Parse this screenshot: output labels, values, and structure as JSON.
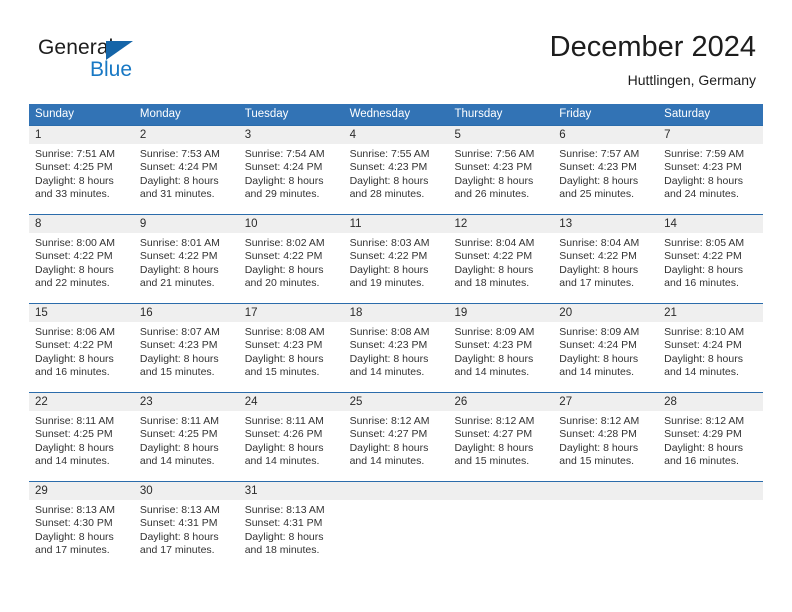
{
  "brand": {
    "word1": "General",
    "word2": "Blue",
    "triangle_color": "#1565a8",
    "blue_text_color": "#1878c4"
  },
  "header": {
    "title": "December 2024",
    "subtitle": "Huttlingen, Germany",
    "accent_color": "#3273b5",
    "daynum_band_color": "#efefef"
  },
  "weekdays": [
    "Sunday",
    "Monday",
    "Tuesday",
    "Wednesday",
    "Thursday",
    "Friday",
    "Saturday"
  ],
  "weeks": [
    [
      {
        "day": "1",
        "sunrise": "Sunrise: 7:51 AM",
        "sunset": "Sunset: 4:25 PM",
        "daylight1": "Daylight: 8 hours",
        "daylight2": "and 33 minutes."
      },
      {
        "day": "2",
        "sunrise": "Sunrise: 7:53 AM",
        "sunset": "Sunset: 4:24 PM",
        "daylight1": "Daylight: 8 hours",
        "daylight2": "and 31 minutes."
      },
      {
        "day": "3",
        "sunrise": "Sunrise: 7:54 AM",
        "sunset": "Sunset: 4:24 PM",
        "daylight1": "Daylight: 8 hours",
        "daylight2": "and 29 minutes."
      },
      {
        "day": "4",
        "sunrise": "Sunrise: 7:55 AM",
        "sunset": "Sunset: 4:23 PM",
        "daylight1": "Daylight: 8 hours",
        "daylight2": "and 28 minutes."
      },
      {
        "day": "5",
        "sunrise": "Sunrise: 7:56 AM",
        "sunset": "Sunset: 4:23 PM",
        "daylight1": "Daylight: 8 hours",
        "daylight2": "and 26 minutes."
      },
      {
        "day": "6",
        "sunrise": "Sunrise: 7:57 AM",
        "sunset": "Sunset: 4:23 PM",
        "daylight1": "Daylight: 8 hours",
        "daylight2": "and 25 minutes."
      },
      {
        "day": "7",
        "sunrise": "Sunrise: 7:59 AM",
        "sunset": "Sunset: 4:23 PM",
        "daylight1": "Daylight: 8 hours",
        "daylight2": "and 24 minutes."
      }
    ],
    [
      {
        "day": "8",
        "sunrise": "Sunrise: 8:00 AM",
        "sunset": "Sunset: 4:22 PM",
        "daylight1": "Daylight: 8 hours",
        "daylight2": "and 22 minutes."
      },
      {
        "day": "9",
        "sunrise": "Sunrise: 8:01 AM",
        "sunset": "Sunset: 4:22 PM",
        "daylight1": "Daylight: 8 hours",
        "daylight2": "and 21 minutes."
      },
      {
        "day": "10",
        "sunrise": "Sunrise: 8:02 AM",
        "sunset": "Sunset: 4:22 PM",
        "daylight1": "Daylight: 8 hours",
        "daylight2": "and 20 minutes."
      },
      {
        "day": "11",
        "sunrise": "Sunrise: 8:03 AM",
        "sunset": "Sunset: 4:22 PM",
        "daylight1": "Daylight: 8 hours",
        "daylight2": "and 19 minutes."
      },
      {
        "day": "12",
        "sunrise": "Sunrise: 8:04 AM",
        "sunset": "Sunset: 4:22 PM",
        "daylight1": "Daylight: 8 hours",
        "daylight2": "and 18 minutes."
      },
      {
        "day": "13",
        "sunrise": "Sunrise: 8:04 AM",
        "sunset": "Sunset: 4:22 PM",
        "daylight1": "Daylight: 8 hours",
        "daylight2": "and 17 minutes."
      },
      {
        "day": "14",
        "sunrise": "Sunrise: 8:05 AM",
        "sunset": "Sunset: 4:22 PM",
        "daylight1": "Daylight: 8 hours",
        "daylight2": "and 16 minutes."
      }
    ],
    [
      {
        "day": "15",
        "sunrise": "Sunrise: 8:06 AM",
        "sunset": "Sunset: 4:22 PM",
        "daylight1": "Daylight: 8 hours",
        "daylight2": "and 16 minutes."
      },
      {
        "day": "16",
        "sunrise": "Sunrise: 8:07 AM",
        "sunset": "Sunset: 4:23 PM",
        "daylight1": "Daylight: 8 hours",
        "daylight2": "and 15 minutes."
      },
      {
        "day": "17",
        "sunrise": "Sunrise: 8:08 AM",
        "sunset": "Sunset: 4:23 PM",
        "daylight1": "Daylight: 8 hours",
        "daylight2": "and 15 minutes."
      },
      {
        "day": "18",
        "sunrise": "Sunrise: 8:08 AM",
        "sunset": "Sunset: 4:23 PM",
        "daylight1": "Daylight: 8 hours",
        "daylight2": "and 14 minutes."
      },
      {
        "day": "19",
        "sunrise": "Sunrise: 8:09 AM",
        "sunset": "Sunset: 4:23 PM",
        "daylight1": "Daylight: 8 hours",
        "daylight2": "and 14 minutes."
      },
      {
        "day": "20",
        "sunrise": "Sunrise: 8:09 AM",
        "sunset": "Sunset: 4:24 PM",
        "daylight1": "Daylight: 8 hours",
        "daylight2": "and 14 minutes."
      },
      {
        "day": "21",
        "sunrise": "Sunrise: 8:10 AM",
        "sunset": "Sunset: 4:24 PM",
        "daylight1": "Daylight: 8 hours",
        "daylight2": "and 14 minutes."
      }
    ],
    [
      {
        "day": "22",
        "sunrise": "Sunrise: 8:11 AM",
        "sunset": "Sunset: 4:25 PM",
        "daylight1": "Daylight: 8 hours",
        "daylight2": "and 14 minutes."
      },
      {
        "day": "23",
        "sunrise": "Sunrise: 8:11 AM",
        "sunset": "Sunset: 4:25 PM",
        "daylight1": "Daylight: 8 hours",
        "daylight2": "and 14 minutes."
      },
      {
        "day": "24",
        "sunrise": "Sunrise: 8:11 AM",
        "sunset": "Sunset: 4:26 PM",
        "daylight1": "Daylight: 8 hours",
        "daylight2": "and 14 minutes."
      },
      {
        "day": "25",
        "sunrise": "Sunrise: 8:12 AM",
        "sunset": "Sunset: 4:27 PM",
        "daylight1": "Daylight: 8 hours",
        "daylight2": "and 14 minutes."
      },
      {
        "day": "26",
        "sunrise": "Sunrise: 8:12 AM",
        "sunset": "Sunset: 4:27 PM",
        "daylight1": "Daylight: 8 hours",
        "daylight2": "and 15 minutes."
      },
      {
        "day": "27",
        "sunrise": "Sunrise: 8:12 AM",
        "sunset": "Sunset: 4:28 PM",
        "daylight1": "Daylight: 8 hours",
        "daylight2": "and 15 minutes."
      },
      {
        "day": "28",
        "sunrise": "Sunrise: 8:12 AM",
        "sunset": "Sunset: 4:29 PM",
        "daylight1": "Daylight: 8 hours",
        "daylight2": "and 16 minutes."
      }
    ],
    [
      {
        "day": "29",
        "sunrise": "Sunrise: 8:13 AM",
        "sunset": "Sunset: 4:30 PM",
        "daylight1": "Daylight: 8 hours",
        "daylight2": "and 17 minutes."
      },
      {
        "day": "30",
        "sunrise": "Sunrise: 8:13 AM",
        "sunset": "Sunset: 4:31 PM",
        "daylight1": "Daylight: 8 hours",
        "daylight2": "and 17 minutes."
      },
      {
        "day": "31",
        "sunrise": "Sunrise: 8:13 AM",
        "sunset": "Sunset: 4:31 PM",
        "daylight1": "Daylight: 8 hours",
        "daylight2": "and 18 minutes."
      },
      {
        "day": "",
        "sunrise": "",
        "sunset": "",
        "daylight1": "",
        "daylight2": ""
      },
      {
        "day": "",
        "sunrise": "",
        "sunset": "",
        "daylight1": "",
        "daylight2": ""
      },
      {
        "day": "",
        "sunrise": "",
        "sunset": "",
        "daylight1": "",
        "daylight2": ""
      },
      {
        "day": "",
        "sunrise": "",
        "sunset": "",
        "daylight1": "",
        "daylight2": ""
      }
    ]
  ]
}
